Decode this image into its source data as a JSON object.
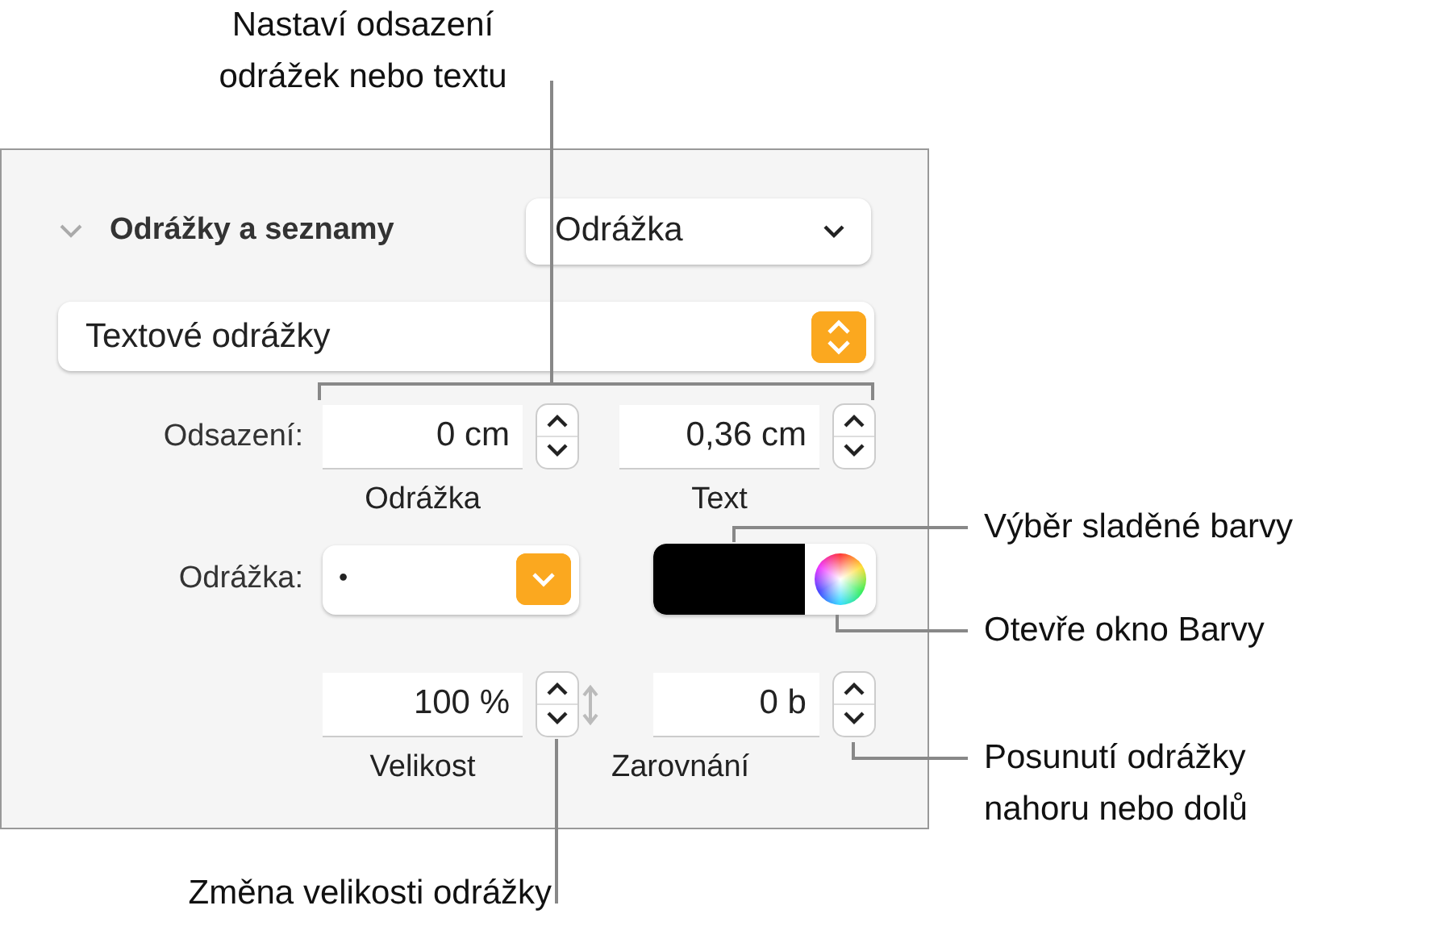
{
  "panel": {
    "section": {
      "title": "Odrážky a seznamy",
      "expanded": true,
      "style_menu": "Odrážka"
    },
    "bullet_type": "Textové odrážky",
    "indent": {
      "label": "Odsazení:",
      "fields": [
        {
          "value": "0 cm",
          "caption": "Odrážka"
        },
        {
          "value": "0,36 cm",
          "caption": "Text"
        }
      ]
    },
    "bullet": {
      "label": "Odrážka:",
      "value": "•",
      "color": "#000000"
    },
    "size": {
      "value": "100 %",
      "caption": "Velikost"
    },
    "alignment": {
      "value": "0 b",
      "caption": "Zarovnání"
    }
  },
  "callouts": [
    {
      "lines": [
        "Nastaví odsazení",
        "odrážek nebo textu"
      ]
    },
    {
      "lines": [
        "Výběr sladěné barvy"
      ]
    },
    {
      "lines": [
        "Otevře okno Barvy"
      ]
    },
    {
      "lines": [
        "Posunutí odrážky",
        "nahoru nebo dolů"
      ]
    },
    {
      "lines": [
        "Změna velikosti odrážky"
      ]
    }
  ]
}
